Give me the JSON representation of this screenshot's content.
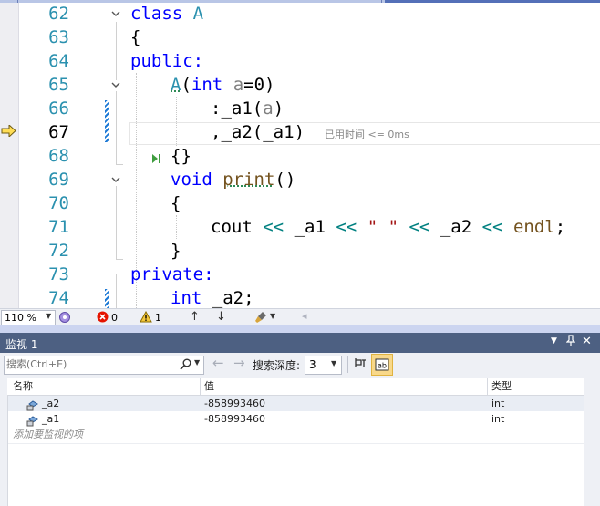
{
  "editor": {
    "lines": [
      {
        "num": "62"
      },
      {
        "num": "63"
      },
      {
        "num": "64"
      },
      {
        "num": "65"
      },
      {
        "num": "66"
      },
      {
        "num": "67"
      },
      {
        "num": "68"
      },
      {
        "num": "69"
      },
      {
        "num": "70"
      },
      {
        "num": "71"
      },
      {
        "num": "72"
      },
      {
        "num": "73"
      },
      {
        "num": "74"
      }
    ],
    "code": {
      "l62_kw": "class",
      "l62_name": "A",
      "l63": "{",
      "l64": "public:",
      "l65_fn": "A",
      "l65_open": "(",
      "l65_kw": "int",
      "l65_param": "a",
      "l65_rest": "=0)",
      "l66_colon": ":",
      "l66_mem": "_a1",
      "l66_open": "(",
      "l66_param": "a",
      "l66_close": ")",
      "l67_comma": ",",
      "l67_mem": "_a2",
      "l67_open": "(",
      "l67_arg": "_a1",
      "l67_close": ")",
      "l67_hint": "已用时间 <= 0ms",
      "l68": "{}",
      "l69_kw": "void",
      "l69_fn": "print",
      "l69_rest": "()",
      "l70": "{",
      "l71_cout": "cout",
      "l71_op1": "<<",
      "l71_a1": "_a1",
      "l71_op2": "<<",
      "l71_str": "\" \"",
      "l71_op3": "<<",
      "l71_a2": "_a2",
      "l71_op4": "<<",
      "l71_endl": "endl",
      "l71_semi": ";",
      "l72": "}",
      "l73": "private:",
      "l74_kw": "int",
      "l74_mem": "_a2;"
    }
  },
  "status": {
    "zoom": "110 %",
    "errors": "0",
    "warnings": "1"
  },
  "watch": {
    "title": "监视 1",
    "search_placeholder": "搜索(Ctrl+E)",
    "depth_label": "搜索深度:",
    "depth_value": "3",
    "columns": {
      "name": "名称",
      "value": "值",
      "type": "类型"
    },
    "rows": [
      {
        "name": "_a2",
        "value": "-858993460",
        "type": "int"
      },
      {
        "name": "_a1",
        "value": "-858993460",
        "type": "int"
      }
    ],
    "add_item": "添加要监视的项"
  },
  "colors": {
    "keyword": "#0000ff",
    "type": "#2b91af",
    "function": "#74531f",
    "parameter": "#808080",
    "string": "#a31515",
    "operator": "#008080",
    "watch_header": "#4d6082"
  }
}
